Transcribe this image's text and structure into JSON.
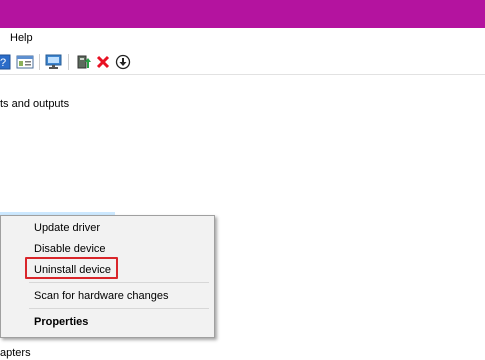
{
  "menubar": {
    "help_label": "Help"
  },
  "toolbar": {
    "icons": [
      "help-icon",
      "properties-icon",
      "scan-monitor-icon",
      "update-driver-icon",
      "uninstall-icon",
      "download-icon"
    ],
    "colors": {
      "uninstall": "#e81123",
      "update": "#2e8b57"
    }
  },
  "tree": {
    "audio_label_fragment": "ts and outputs",
    "selected_device_fragment": "",
    "adapters_label_fragment": "apters"
  },
  "context_menu": {
    "items": [
      {
        "label": "Update driver"
      },
      {
        "label": "Disable device"
      },
      {
        "label": "Uninstall device",
        "highlighted": true
      },
      {
        "label": "Scan for hardware changes"
      },
      {
        "label": "Properties",
        "bold": true
      }
    ],
    "highlight_color": "#d9262b"
  },
  "colors": {
    "titlebar": "#b4139f",
    "selection": "#cce8ff",
    "menu_background": "#f2f2f2"
  }
}
